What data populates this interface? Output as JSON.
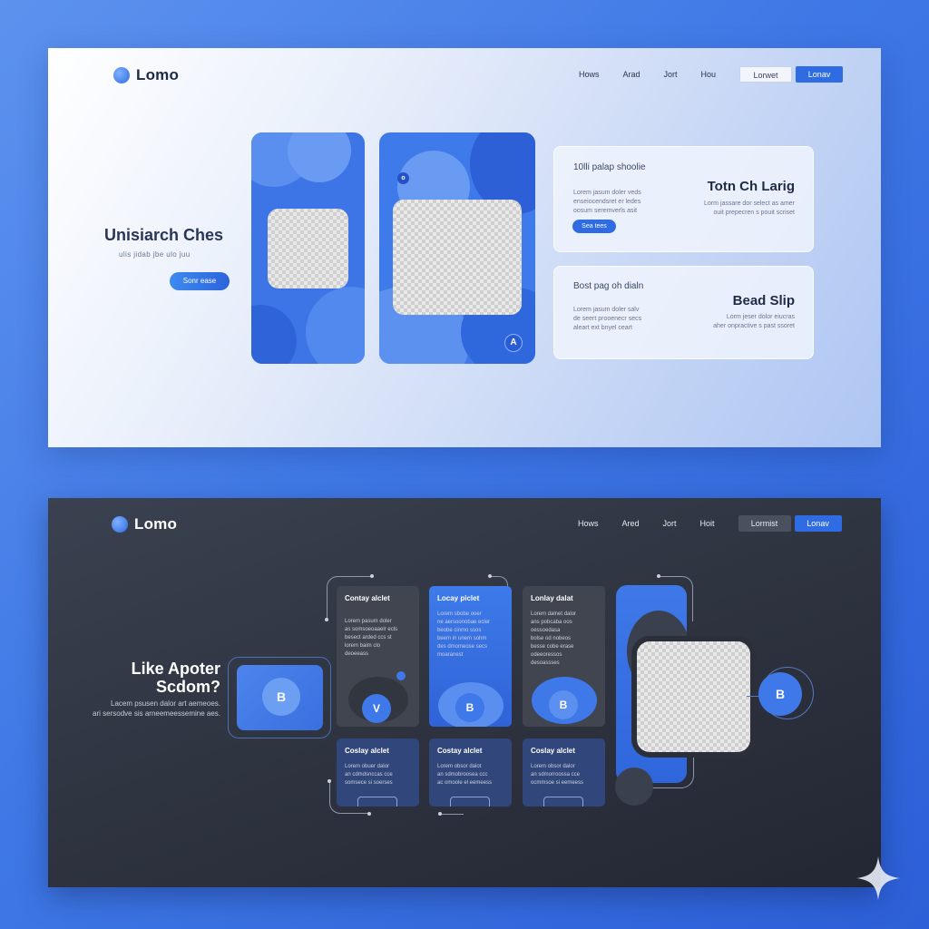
{
  "light": {
    "logo": "Lomo",
    "nav": [
      "Hows",
      "Arad",
      "Jort",
      "Hou"
    ],
    "btn_outline": "Lorwet",
    "btn_solid": "Lonav",
    "hero_title": "Unisiarch Ches",
    "hero_sub": "ulis jidab jbe ulo juu",
    "hero_btn": "Sonr ease",
    "card1": {
      "title": "10lli palap shoolie",
      "body": "Lorem jasum doler veds\nenseiocendsret er ledes\noosum seremverls asit",
      "pill": "Sea tees",
      "right_title": "Totn Ch Larig",
      "right_body": "Lorm jassare dor select as amer\nouit prepecren s pouit scriset"
    },
    "card2": {
      "title": "Bost pag oh dialn",
      "body": "Lorem jasum doler salv\nde seert prooenecr secs\naleart ext bnyel ceart",
      "right_title": "Bead Slip",
      "right_body": "Lorm jeser dolor eiucras\naher onpractive s past ssoret"
    },
    "phone2_badge": "A",
    "phone2_dot": "o"
  },
  "dark": {
    "logo": "Lomo",
    "nav": [
      "Hows",
      "Ared",
      "Jort",
      "Hoit"
    ],
    "btn_outline": "Lormist",
    "btn_solid": "Lonav",
    "hero_title": "Like Apoter\nScdom?",
    "hero_sub": "Lacem psusen dalor art aemeoes.\nari sersodve sis arneemeessemine aes.",
    "left_badge": "B",
    "right_badge": "B",
    "top_cards": [
      {
        "title": "Contay alclet",
        "body": "Lorem pasum doler\nas somsoeoaaelr ecls\nbesect arded ccs st\nlorem baim clo\ndeoeeass",
        "badge": "V"
      },
      {
        "title": "Locay piclet",
        "body": "Lorem sbobe ooer\nne aersoonobae ecler\nbeobe cinmo ssos\nbeem in unem sohm\ndes dmomeose secs\nmoaranest",
        "badge": "B"
      },
      {
        "title": "Lonlay dalat",
        "body": "Lorem dalnet dalor\nans pobcaba oos\noessoedasa\nbolse od nobeos\nbesse cobe erase\nodeeoressos\ndesoassses",
        "badge": "B"
      }
    ],
    "bottom_cards": [
      {
        "title": "Coslay alclet",
        "body": "Lorem obuer dalor\nan cdmdsnccas cce\nsomsece si soerses"
      },
      {
        "title": "Costay alclet",
        "body": "Lorem obsor dalot\nan sdmobroosea ccc\nac omoole el eemeess"
      },
      {
        "title": "Coslay alclet",
        "body": "Lorem obsor dalor\nan sdmorroossa cce\nocmmsoe si eemeess"
      }
    ],
    "accent": "#3f78e8"
  }
}
